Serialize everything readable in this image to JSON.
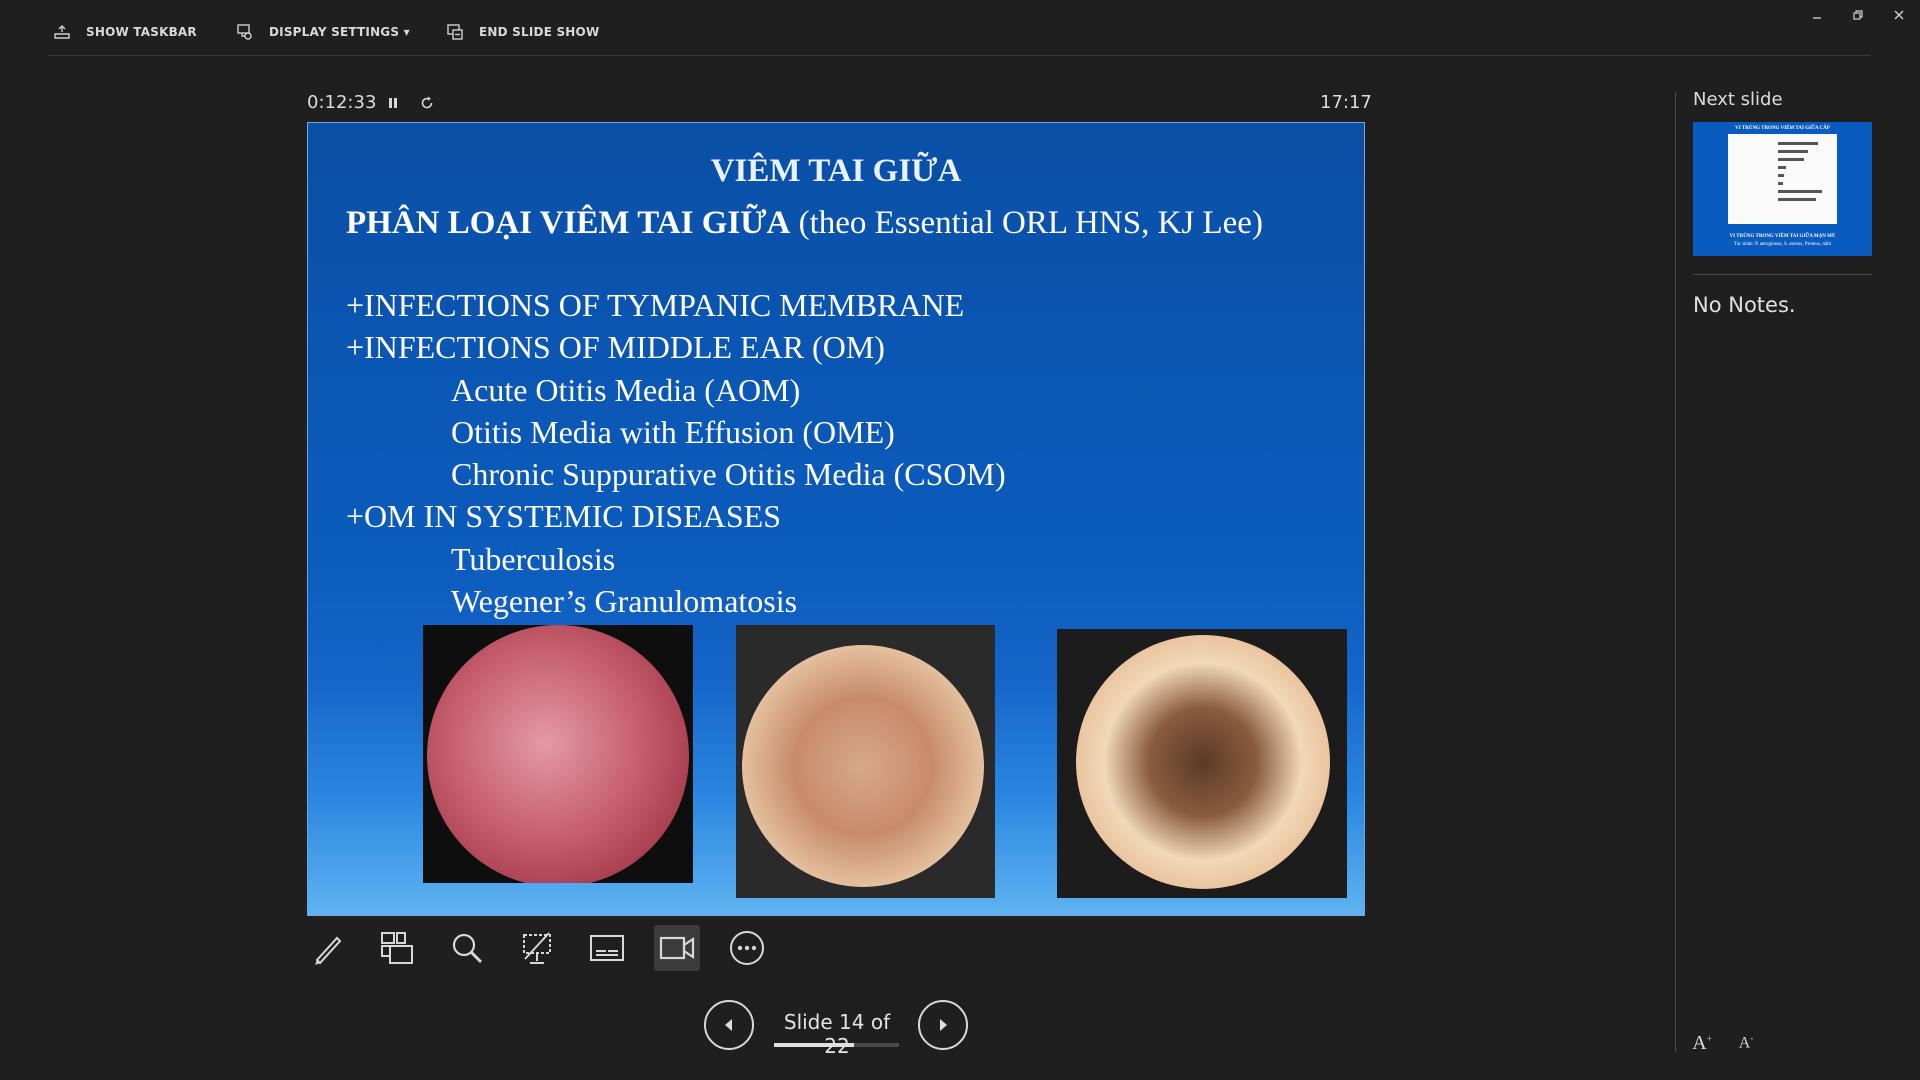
{
  "toolbar": {
    "show_taskbar": "SHOW TASKBAR",
    "display_settings": "DISPLAY SETTINGS ▾",
    "end_slide_show": "END SLIDE SHOW"
  },
  "timer": {
    "elapsed": "0:12:33",
    "clock": "17:17"
  },
  "slide": {
    "title": "VIÊM TAI GIỮA",
    "subtitle_bold": "PHÂN LOẠI VIÊM TAI GIỮA",
    "subtitle_rest": " (theo Essential ORL HNS, KJ Lee)",
    "lines": [
      "+INFECTIONS OF TYMPANIC MEMBRANE",
      "+INFECTIONS OF MIDDLE EAR (OM)",
      "Acute Otitis Media (AOM)",
      "Otitis Media with Effusion  (OME)",
      "Chronic Suppurative Otitis Media (CSOM)",
      "+OM IN SYSTEMIC DISEASES",
      "Tuberculosis",
      "Wegener’s Granulomatosis"
    ]
  },
  "navigation": {
    "counter": "Slide 14 of 22",
    "current": 14,
    "total": 22
  },
  "next_slide": {
    "label": "Next slide",
    "thumb_title": "VI TRÙNG TRONG VIÊM TAI GIỮA CẤP",
    "thumb_caption1": "VI TRÙNG TRONG VIÊM TAI GIỮA MẠN MỦ",
    "thumb_caption2": "Tác nhân: P. aeruginosa, S. aureus, Proteus, nấm"
  },
  "notes": {
    "text": "No Notes."
  },
  "icons": {
    "tools": [
      "pen-icon",
      "see-all-slides-icon",
      "zoom-icon",
      "black-screen-icon",
      "subtitles-icon",
      "camera-icon",
      "more-options-icon"
    ],
    "active_tool": "camera-icon"
  },
  "colors": {
    "background": "#1f1f1f",
    "slide_blue": "#0b5cbd",
    "text": "#e6e6e6"
  }
}
